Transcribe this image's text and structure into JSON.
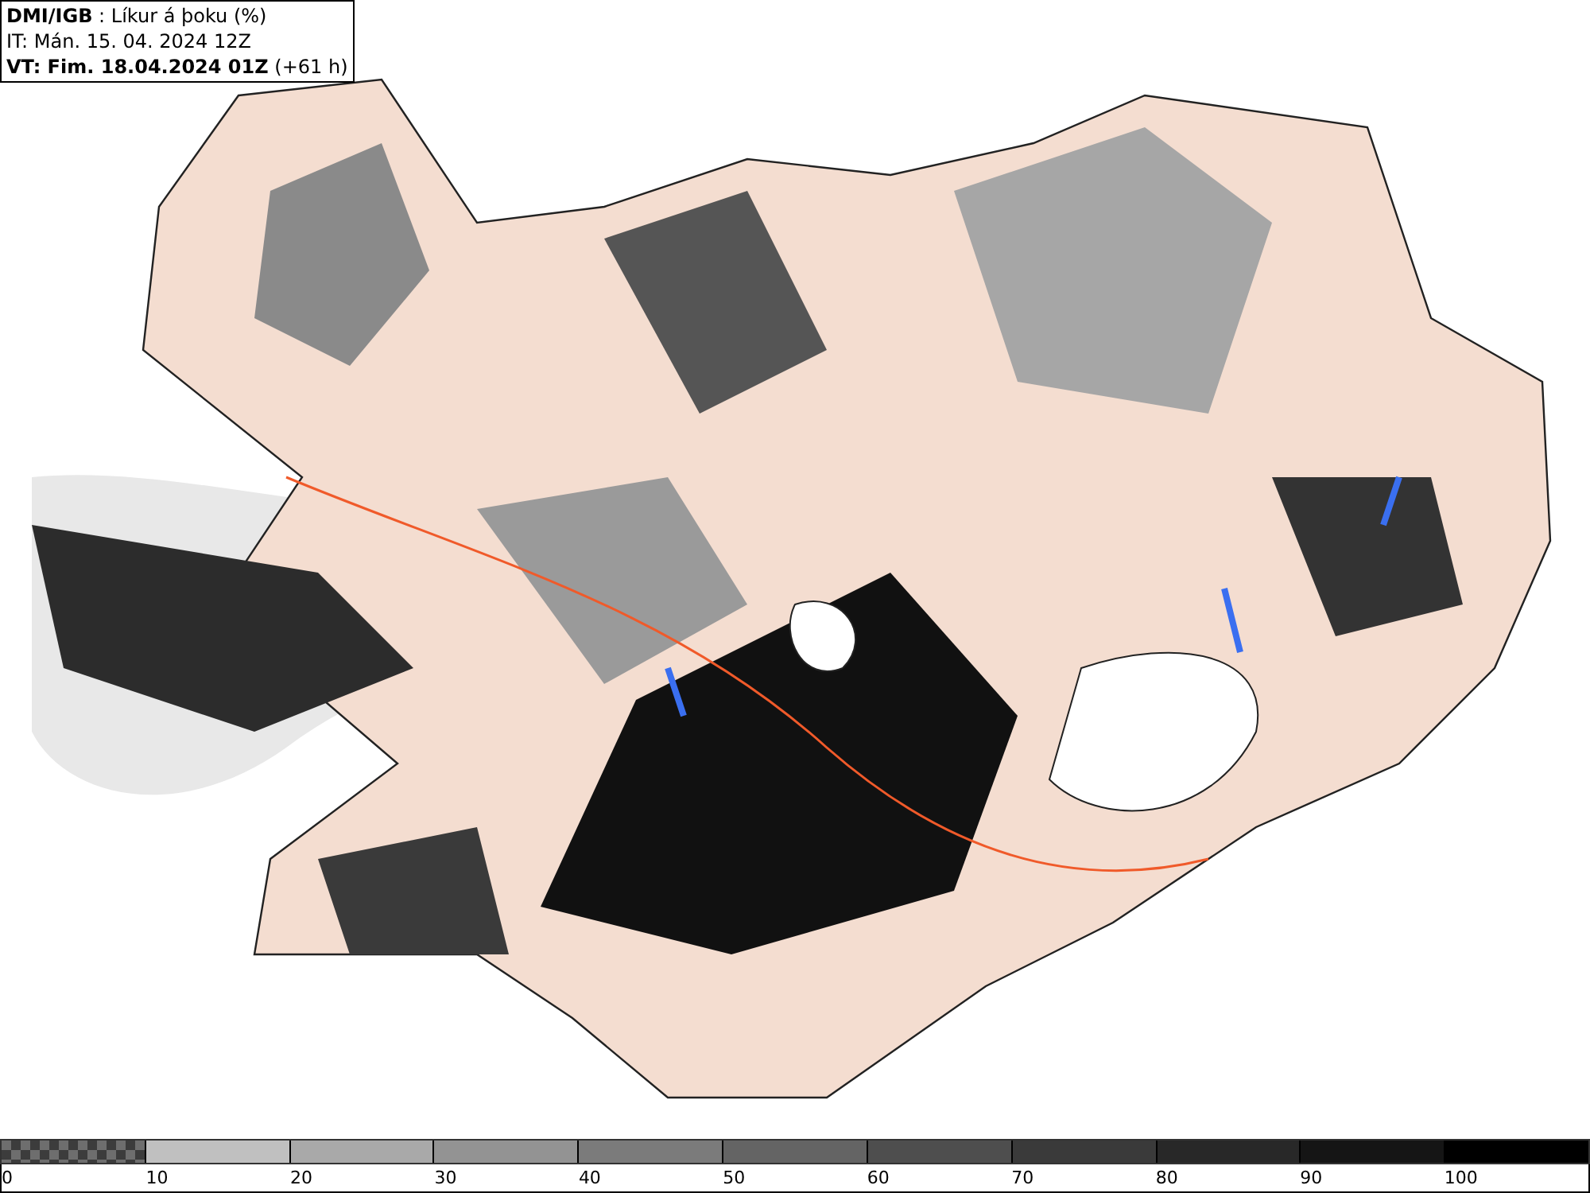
{
  "header": {
    "lines": [
      "**DMI/IGB** : Líkur á þoku (%)",
      "IT: Mán. 15. 04. 2024 12Z",
      "**VT: Fim. 18.04.2024 01Z** (+61 h)"
    ]
  },
  "legend": {
    "items": [
      {
        "label": "0",
        "kind": "checker",
        "color": "#6e6e6e"
      },
      {
        "label": "10",
        "kind": "solid",
        "color": "#c0c0c0"
      },
      {
        "label": "20",
        "kind": "solid",
        "color": "#a9a9a9"
      },
      {
        "label": "30",
        "kind": "solid",
        "color": "#939393"
      },
      {
        "label": "40",
        "kind": "solid",
        "color": "#7b7b7b"
      },
      {
        "label": "50",
        "kind": "solid",
        "color": "#646464"
      },
      {
        "label": "60",
        "kind": "solid",
        "color": "#4e4e4e"
      },
      {
        "label": "70",
        "kind": "solid",
        "color": "#3a3a3a"
      },
      {
        "label": "80",
        "kind": "solid",
        "color": "#282828"
      },
      {
        "label": "90",
        "kind": "solid",
        "color": "#151515"
      },
      {
        "label": "100",
        "kind": "solid",
        "color": "#000000"
      }
    ]
  }
}
